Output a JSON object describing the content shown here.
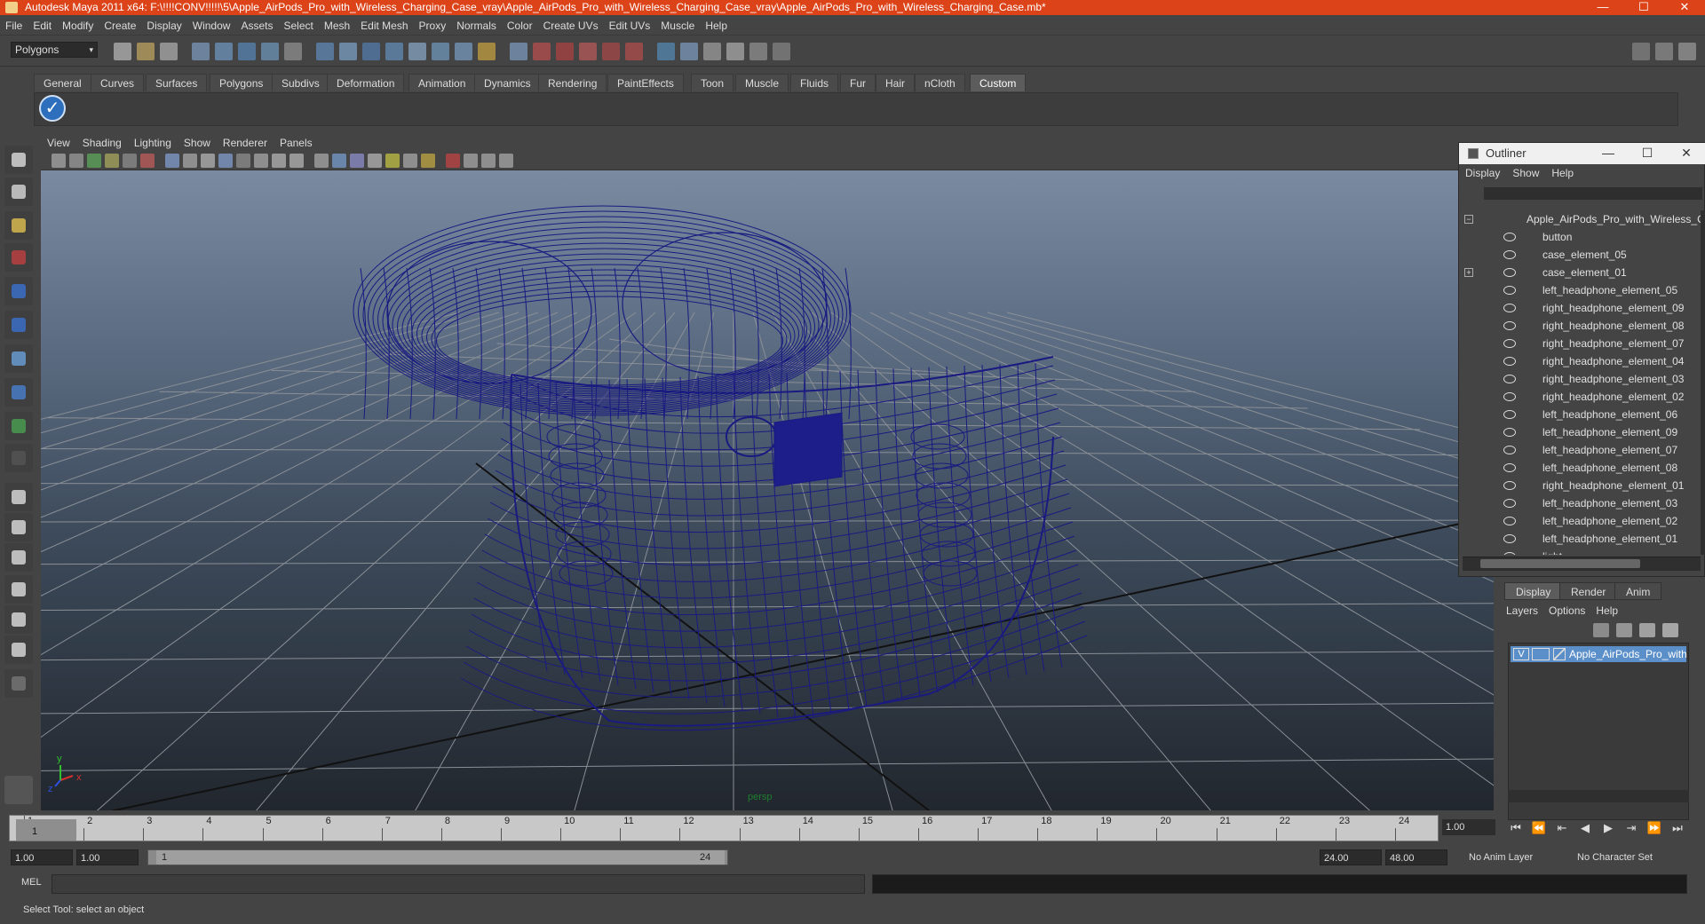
{
  "window": {
    "title": "Autodesk Maya 2011 x64: F:\\!!!!CONV!!!!!\\5\\Apple_AirPods_Pro_with_Wireless_Charging_Case_vray\\Apple_AirPods_Pro_with_Wireless_Charging_Case_vray\\Apple_AirPods_Pro_with_Wireless_Charging_Case.mb*",
    "minimize": "—",
    "maximize": "☐",
    "close": "✕"
  },
  "menubar": [
    "File",
    "Edit",
    "Modify",
    "Create",
    "Display",
    "Window",
    "Assets",
    "Select",
    "Mesh",
    "Edit Mesh",
    "Proxy",
    "Normals",
    "Color",
    "Create UVs",
    "Edit UVs",
    "Muscle",
    "Help"
  ],
  "mode_selector": {
    "value": "Polygons",
    "arrow": "▾"
  },
  "shelf_tabs": [
    "General",
    "Curves",
    "Surfaces",
    "Polygons",
    "Subdivs",
    "Deformation",
    "Animation",
    "Dynamics",
    "Rendering",
    "PaintEffects",
    "Toon",
    "Muscle",
    "Fluids",
    "Fur",
    "Hair",
    "nCloth",
    "Custom"
  ],
  "shelf_active_tab": "Custom",
  "shelf_button_icon": "check-icon",
  "shelf_button_glyph": "✓",
  "viewport": {
    "menu": [
      "View",
      "Shading",
      "Lighting",
      "Show",
      "Renderer",
      "Panels"
    ],
    "camera_label": "persp",
    "wire_color": "#1a1a80",
    "axis": {
      "x": "x",
      "y": "y",
      "z": "z"
    }
  },
  "outliner": {
    "title": "Outliner",
    "menu": [
      "Display",
      "Show",
      "Help"
    ],
    "root": "Apple_AirPods_Pro_with_Wireless_Char",
    "root_expand": "−",
    "items": [
      {
        "label": "button",
        "expand": ""
      },
      {
        "label": "case_element_05",
        "expand": ""
      },
      {
        "label": "case_element_01",
        "expand": "+"
      },
      {
        "label": "left_headphone_element_05",
        "expand": ""
      },
      {
        "label": "right_headphone_element_09",
        "expand": ""
      },
      {
        "label": "right_headphone_element_08",
        "expand": ""
      },
      {
        "label": "right_headphone_element_07",
        "expand": ""
      },
      {
        "label": "right_headphone_element_04",
        "expand": ""
      },
      {
        "label": "right_headphone_element_03",
        "expand": ""
      },
      {
        "label": "right_headphone_element_02",
        "expand": ""
      },
      {
        "label": "left_headphone_element_06",
        "expand": ""
      },
      {
        "label": "left_headphone_element_09",
        "expand": ""
      },
      {
        "label": "left_headphone_element_07",
        "expand": ""
      },
      {
        "label": "left_headphone_element_08",
        "expand": ""
      },
      {
        "label": "right_headphone_element_01",
        "expand": ""
      },
      {
        "label": "left_headphone_element_03",
        "expand": ""
      },
      {
        "label": "left_headphone_element_02",
        "expand": ""
      },
      {
        "label": "left_headphone_element_01",
        "expand": ""
      },
      {
        "label": "light",
        "expand": ""
      }
    ]
  },
  "layers": {
    "tabs": [
      "Display",
      "Render",
      "Anim"
    ],
    "active_tab": "Display",
    "menu": [
      "Layers",
      "Options",
      "Help"
    ],
    "layer": {
      "visible": "V",
      "name": "Apple_AirPods_Pro_with"
    }
  },
  "timeline": {
    "ticks": [
      "1",
      "2",
      "3",
      "4",
      "5",
      "6",
      "7",
      "8",
      "9",
      "10",
      "11",
      "12",
      "13",
      "14",
      "15",
      "16",
      "17",
      "18",
      "19",
      "20",
      "21",
      "22",
      "23",
      "24"
    ],
    "current_frame": "1",
    "current_time": "1.00"
  },
  "playback": [
    "⏮",
    "⏪",
    "⇤",
    "◀",
    "▶",
    "⇥",
    "⏩",
    "⏭"
  ],
  "range": {
    "start": "1.00",
    "playback_start": "1.00",
    "bar_start": "1",
    "bar_end": "24",
    "playback_end": "24.00",
    "end": "48.00",
    "anim_layer": "No Anim Layer",
    "character_set": "No Character Set"
  },
  "command": {
    "label": "MEL"
  },
  "help_line": "Select Tool: select an object",
  "colors": {
    "title_bar": "#dd4318",
    "ui_bg": "#444444",
    "selection": "#5b8fc9"
  }
}
